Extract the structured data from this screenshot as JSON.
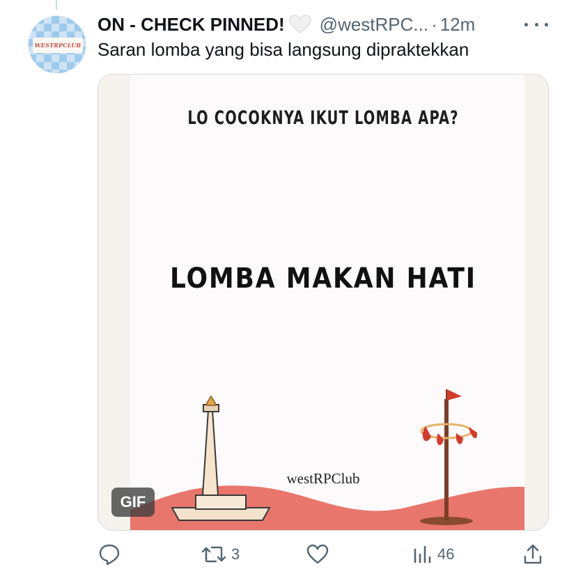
{
  "tweet": {
    "display_name": "ON - CHECK PINNED!",
    "handle": "@westRPC...",
    "separator": "·",
    "time": "12m",
    "text": "Saran lomba yang bisa langsung dipraktekkan",
    "avatar_text": "WESTRPCLUB"
  },
  "media": {
    "question": "LO COCOKNYA IKUT LOMBA APA?",
    "answer": "LOMBA MAKAN HATI",
    "watermark": "westRPClub",
    "badge": "GIF"
  },
  "actions": {
    "reply_count": "",
    "retweet_count": "3",
    "like_count": "",
    "views_count": "46"
  },
  "colors": {
    "text_primary": "#0f1419",
    "text_secondary": "#536471",
    "hill": "#e8766c",
    "flag_red": "#d33b2c"
  },
  "icons": [
    "white-heart-icon",
    "more-icon",
    "reply-icon",
    "retweet-icon",
    "like-icon",
    "views-icon",
    "share-icon"
  ]
}
